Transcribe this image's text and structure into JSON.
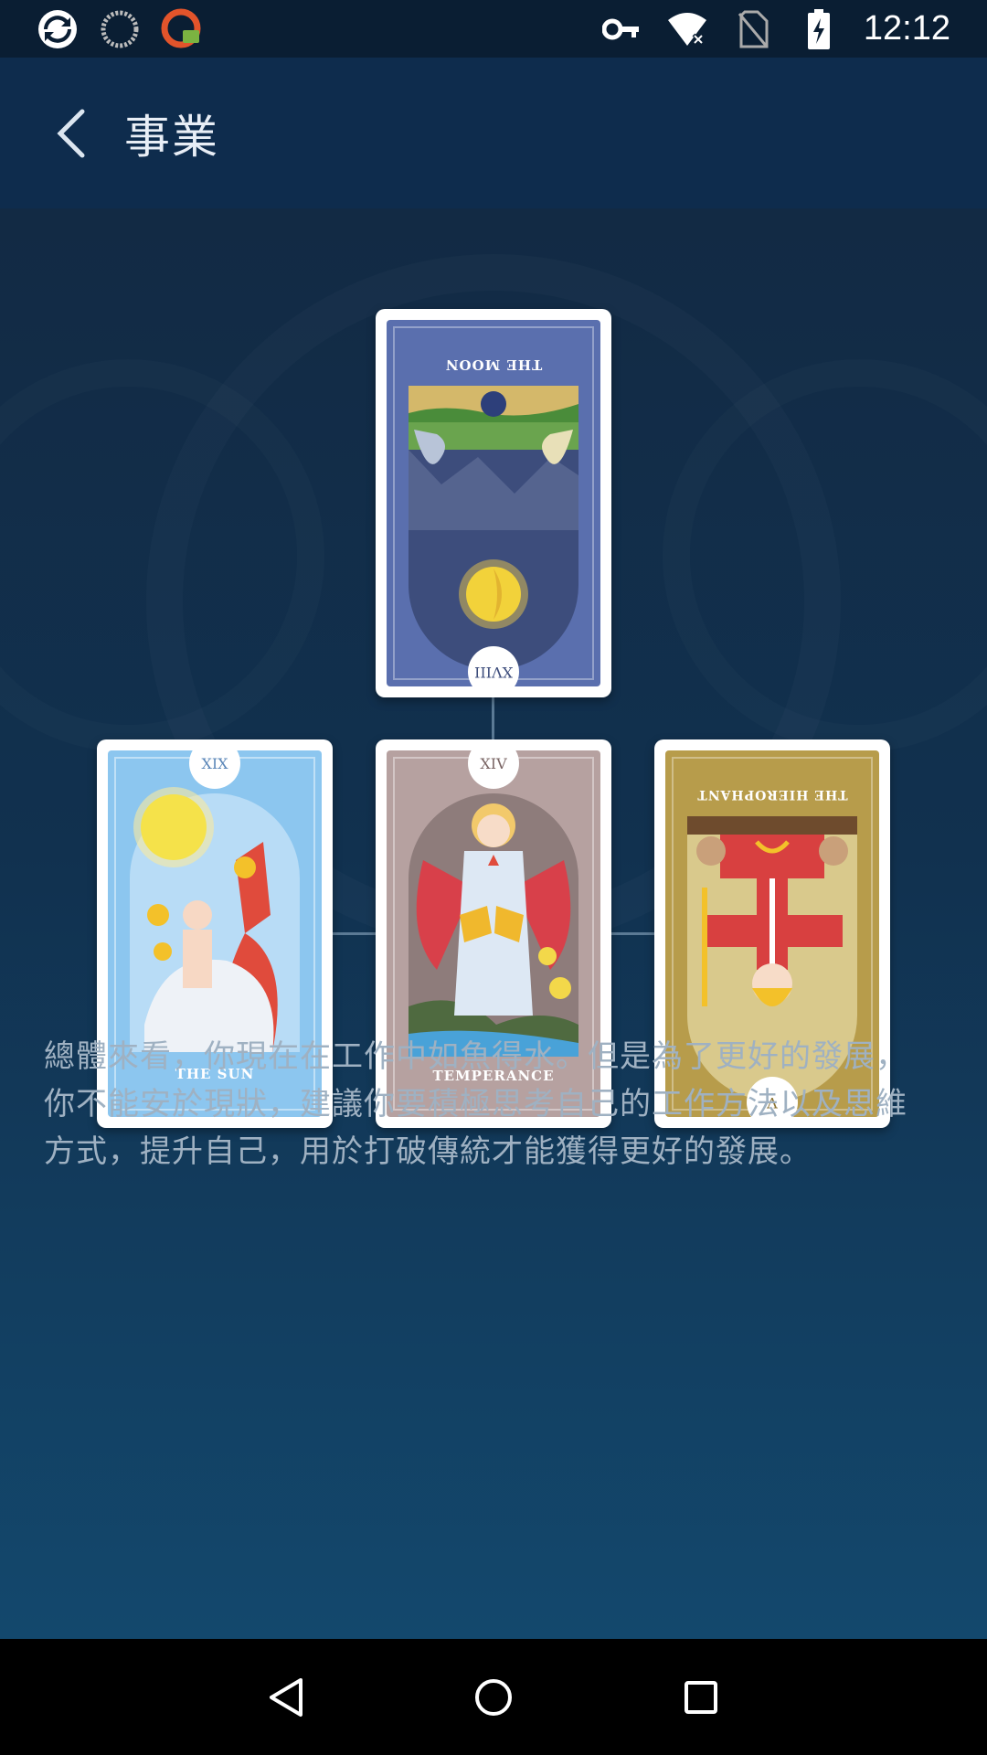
{
  "status_bar": {
    "time": "12:12",
    "left_icons": [
      "app-icon",
      "sync-icon",
      "vpn-app-icon"
    ],
    "right_icons": [
      "vpn-key-icon",
      "wifi-off-icon",
      "no-sim-icon",
      "battery-charging-icon"
    ]
  },
  "app_bar": {
    "back_icon": "chevron-left-icon",
    "title": "事業"
  },
  "cards": {
    "top": {
      "numeral": "XVIII",
      "name": "THE MOON",
      "reversed": true,
      "color": "#5a6fae"
    },
    "left": {
      "numeral": "XIX",
      "name": "THE SUN",
      "reversed": false,
      "color": "#8cc6ef"
    },
    "center": {
      "numeral": "XIV",
      "name": "TEMPERANCE",
      "reversed": false,
      "color": "#b6a1a0"
    },
    "right": {
      "numeral": "V",
      "name": "THE HIEROPHANT",
      "reversed": true,
      "color": "#b79c4b"
    }
  },
  "reading": {
    "lines": [
      "總體來看，你現在在工作中如魚得水。但是為了更好的發展，",
      "你不能安於現狀，建議你要積極思考自己的工作方法以及思維",
      "方式，提升自己，用於打破傳統才能獲得更好的發展。"
    ]
  },
  "nav_bar": {
    "buttons": [
      "back-triangle-icon",
      "home-circle-icon",
      "recents-square-icon"
    ]
  }
}
